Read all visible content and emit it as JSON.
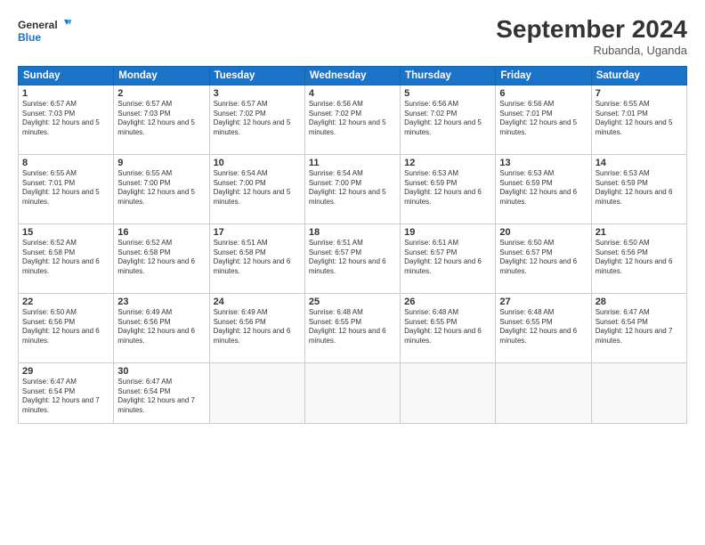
{
  "header": {
    "logo_line1": "General",
    "logo_line2": "Blue",
    "month": "September 2024",
    "location": "Rubanda, Uganda"
  },
  "days_of_week": [
    "Sunday",
    "Monday",
    "Tuesday",
    "Wednesday",
    "Thursday",
    "Friday",
    "Saturday"
  ],
  "weeks": [
    [
      {
        "day": "1",
        "sunrise": "Sunrise: 6:57 AM",
        "sunset": "Sunset: 7:03 PM",
        "daylight": "Daylight: 12 hours and 5 minutes."
      },
      {
        "day": "2",
        "sunrise": "Sunrise: 6:57 AM",
        "sunset": "Sunset: 7:03 PM",
        "daylight": "Daylight: 12 hours and 5 minutes."
      },
      {
        "day": "3",
        "sunrise": "Sunrise: 6:57 AM",
        "sunset": "Sunset: 7:02 PM",
        "daylight": "Daylight: 12 hours and 5 minutes."
      },
      {
        "day": "4",
        "sunrise": "Sunrise: 6:56 AM",
        "sunset": "Sunset: 7:02 PM",
        "daylight": "Daylight: 12 hours and 5 minutes."
      },
      {
        "day": "5",
        "sunrise": "Sunrise: 6:56 AM",
        "sunset": "Sunset: 7:02 PM",
        "daylight": "Daylight: 12 hours and 5 minutes."
      },
      {
        "day": "6",
        "sunrise": "Sunrise: 6:56 AM",
        "sunset": "Sunset: 7:01 PM",
        "daylight": "Daylight: 12 hours and 5 minutes."
      },
      {
        "day": "7",
        "sunrise": "Sunrise: 6:55 AM",
        "sunset": "Sunset: 7:01 PM",
        "daylight": "Daylight: 12 hours and 5 minutes."
      }
    ],
    [
      {
        "day": "8",
        "sunrise": "Sunrise: 6:55 AM",
        "sunset": "Sunset: 7:01 PM",
        "daylight": "Daylight: 12 hours and 5 minutes."
      },
      {
        "day": "9",
        "sunrise": "Sunrise: 6:55 AM",
        "sunset": "Sunset: 7:00 PM",
        "daylight": "Daylight: 12 hours and 5 minutes."
      },
      {
        "day": "10",
        "sunrise": "Sunrise: 6:54 AM",
        "sunset": "Sunset: 7:00 PM",
        "daylight": "Daylight: 12 hours and 5 minutes."
      },
      {
        "day": "11",
        "sunrise": "Sunrise: 6:54 AM",
        "sunset": "Sunset: 7:00 PM",
        "daylight": "Daylight: 12 hours and 5 minutes."
      },
      {
        "day": "12",
        "sunrise": "Sunrise: 6:53 AM",
        "sunset": "Sunset: 6:59 PM",
        "daylight": "Daylight: 12 hours and 6 minutes."
      },
      {
        "day": "13",
        "sunrise": "Sunrise: 6:53 AM",
        "sunset": "Sunset: 6:59 PM",
        "daylight": "Daylight: 12 hours and 6 minutes."
      },
      {
        "day": "14",
        "sunrise": "Sunrise: 6:53 AM",
        "sunset": "Sunset: 6:59 PM",
        "daylight": "Daylight: 12 hours and 6 minutes."
      }
    ],
    [
      {
        "day": "15",
        "sunrise": "Sunrise: 6:52 AM",
        "sunset": "Sunset: 6:58 PM",
        "daylight": "Daylight: 12 hours and 6 minutes."
      },
      {
        "day": "16",
        "sunrise": "Sunrise: 6:52 AM",
        "sunset": "Sunset: 6:58 PM",
        "daylight": "Daylight: 12 hours and 6 minutes."
      },
      {
        "day": "17",
        "sunrise": "Sunrise: 6:51 AM",
        "sunset": "Sunset: 6:58 PM",
        "daylight": "Daylight: 12 hours and 6 minutes."
      },
      {
        "day": "18",
        "sunrise": "Sunrise: 6:51 AM",
        "sunset": "Sunset: 6:57 PM",
        "daylight": "Daylight: 12 hours and 6 minutes."
      },
      {
        "day": "19",
        "sunrise": "Sunrise: 6:51 AM",
        "sunset": "Sunset: 6:57 PM",
        "daylight": "Daylight: 12 hours and 6 minutes."
      },
      {
        "day": "20",
        "sunrise": "Sunrise: 6:50 AM",
        "sunset": "Sunset: 6:57 PM",
        "daylight": "Daylight: 12 hours and 6 minutes."
      },
      {
        "day": "21",
        "sunrise": "Sunrise: 6:50 AM",
        "sunset": "Sunset: 6:56 PM",
        "daylight": "Daylight: 12 hours and 6 minutes."
      }
    ],
    [
      {
        "day": "22",
        "sunrise": "Sunrise: 6:50 AM",
        "sunset": "Sunset: 6:56 PM",
        "daylight": "Daylight: 12 hours and 6 minutes."
      },
      {
        "day": "23",
        "sunrise": "Sunrise: 6:49 AM",
        "sunset": "Sunset: 6:56 PM",
        "daylight": "Daylight: 12 hours and 6 minutes."
      },
      {
        "day": "24",
        "sunrise": "Sunrise: 6:49 AM",
        "sunset": "Sunset: 6:56 PM",
        "daylight": "Daylight: 12 hours and 6 minutes."
      },
      {
        "day": "25",
        "sunrise": "Sunrise: 6:48 AM",
        "sunset": "Sunset: 6:55 PM",
        "daylight": "Daylight: 12 hours and 6 minutes."
      },
      {
        "day": "26",
        "sunrise": "Sunrise: 6:48 AM",
        "sunset": "Sunset: 6:55 PM",
        "daylight": "Daylight: 12 hours and 6 minutes."
      },
      {
        "day": "27",
        "sunrise": "Sunrise: 6:48 AM",
        "sunset": "Sunset: 6:55 PM",
        "daylight": "Daylight: 12 hours and 6 minutes."
      },
      {
        "day": "28",
        "sunrise": "Sunrise: 6:47 AM",
        "sunset": "Sunset: 6:54 PM",
        "daylight": "Daylight: 12 hours and 7 minutes."
      }
    ],
    [
      {
        "day": "29",
        "sunrise": "Sunrise: 6:47 AM",
        "sunset": "Sunset: 6:54 PM",
        "daylight": "Daylight: 12 hours and 7 minutes."
      },
      {
        "day": "30",
        "sunrise": "Sunrise: 6:47 AM",
        "sunset": "Sunset: 6:54 PM",
        "daylight": "Daylight: 12 hours and 7 minutes."
      },
      null,
      null,
      null,
      null,
      null
    ]
  ]
}
